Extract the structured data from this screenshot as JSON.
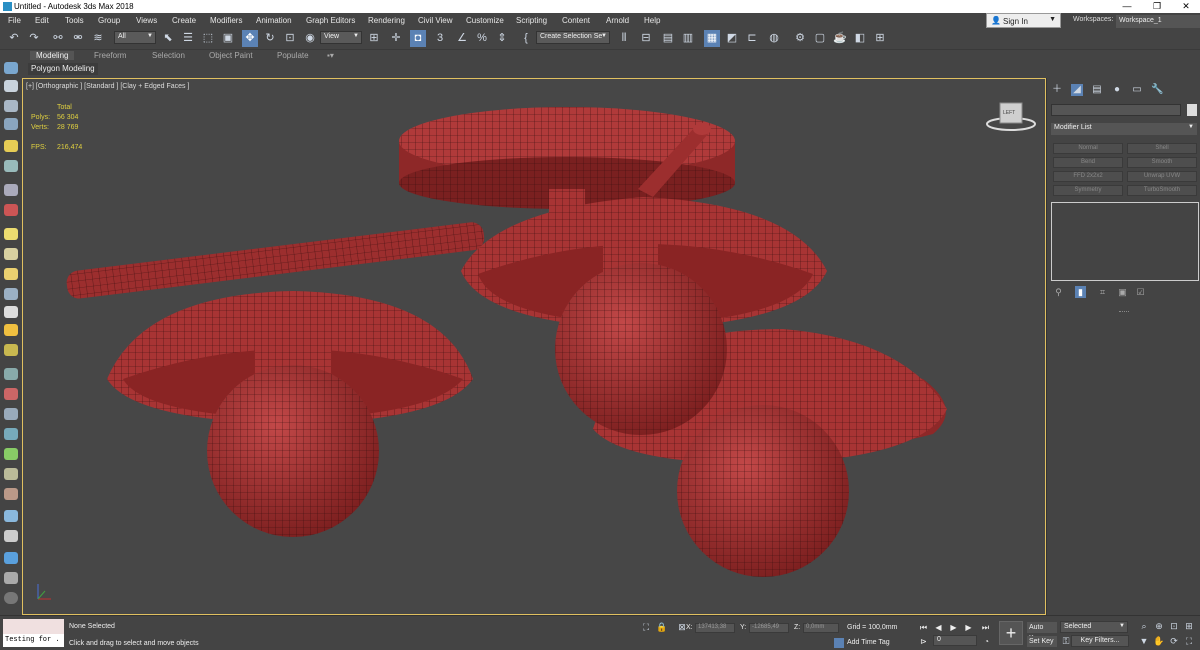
{
  "window": {
    "title": "Untitled - Autodesk 3ds Max 2018",
    "minimize": "—",
    "maximize": "❐",
    "close": "✕"
  },
  "menu": [
    "File",
    "Edit",
    "Tools",
    "Group",
    "Views",
    "Create",
    "Modifiers",
    "Animation",
    "Graph Editors",
    "Rendering",
    "Civil View",
    "Customize",
    "Scripting",
    "Content",
    "Arnold",
    "Help"
  ],
  "account": {
    "signin": "Sign In",
    "workspaces_label": "Workspaces:",
    "workspace": "Workspace_1"
  },
  "toolbar": {
    "filter": "All",
    "coordinate_system": "View",
    "snap_label": "3",
    "angle_snap": "∠",
    "percent_snap": "%",
    "selection_set_placeholder": "Create Selection Se"
  },
  "ribbon": {
    "tabs": [
      "Modeling",
      "Freeform",
      "Selection",
      "Object Paint",
      "Populate"
    ],
    "active_tab": "Modeling",
    "panel": "Polygon Modeling",
    "extra": "▪▾"
  },
  "viewport": {
    "label": "[+] [Orthographic ] [Standard ] [Clay + Edged Faces ]",
    "stats": {
      "header": "Total",
      "polys_label": "Polys:",
      "polys": "56 304",
      "verts_label": "Verts:",
      "verts": "28 769",
      "fps_label": "FPS:",
      "fps": "216,474"
    },
    "viewcube": "LEFT",
    "mesh_color": "#a83434"
  },
  "command_panel": {
    "modifier_list": "Modifier List",
    "modifier_buttons": [
      "Normal",
      "Shell",
      "Bend",
      "Smooth",
      "FFD 2x2x2",
      "Unwrap UVW",
      "Symmetry",
      "TurboSmooth"
    ]
  },
  "status": {
    "maxscript": "Testing for .",
    "selection": "None Selected",
    "hint": "Click and drag to select and move objects",
    "x_label": "X:",
    "x": "137413,38",
    "y_label": "Y:",
    "y": "-12685,49",
    "z_label": "Z:",
    "z": "0,0mm",
    "grid": "Grid = 100,0mm",
    "add_time_tag": "Add Time Tag",
    "frame": "0",
    "auto_key": "Auto Key",
    "set_key": "Set Key",
    "selected": "Selected",
    "key_filters": "Key Filters..."
  },
  "colors": {
    "accent": "#5b82b4",
    "viewport_bg": "#474747",
    "viewport_border": "#e0c060",
    "stats_text": "#e0d040"
  }
}
